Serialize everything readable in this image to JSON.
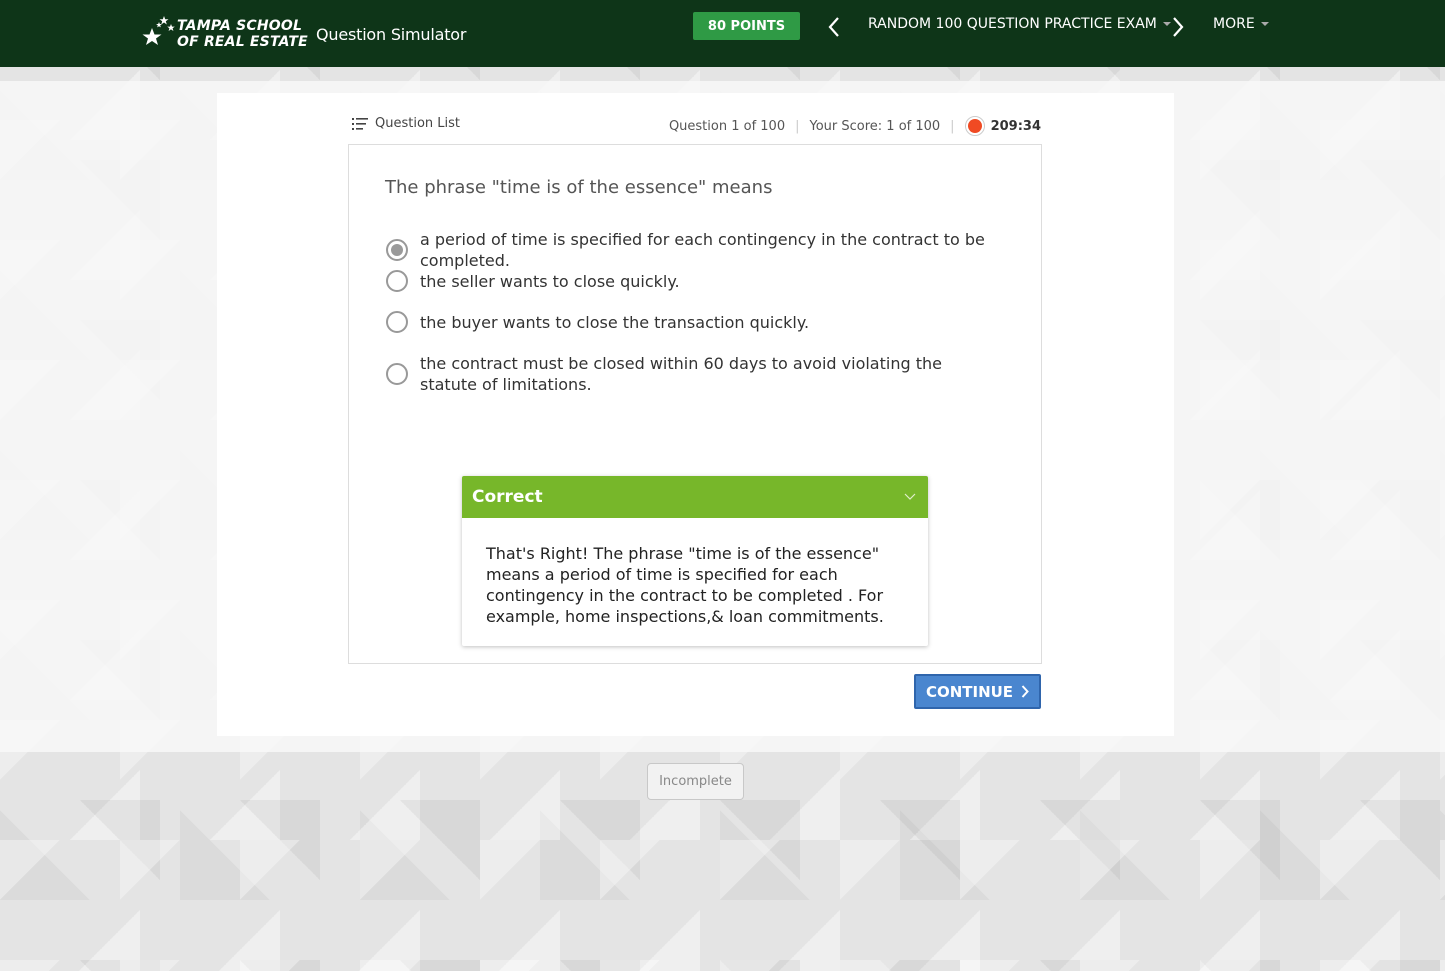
{
  "header": {
    "logo_line1": "TAMPA SCHOOL",
    "logo_line2": "OF REAL ESTATE",
    "app_name": "Question Simulator",
    "points": "80 POINTS",
    "exam_title": "RANDOM 100 QUESTION PRACTICE EXAM",
    "more_label": "MORE"
  },
  "toolbar": {
    "question_list_label": "Question List",
    "question_counter": "Question 1 of 100",
    "score": "Your Score: 1 of 100",
    "timer": "209:34"
  },
  "question": {
    "text": "The phrase \"time is of the essence\" means",
    "options": [
      {
        "label": "a period of time is specified for each contingency in the contract to be completed.",
        "selected": true
      },
      {
        "label": "the seller wants to close quickly.",
        "selected": false
      },
      {
        "label": "the buyer wants to close the transaction quickly.",
        "selected": false
      },
      {
        "label": "the contract must be closed within 60 days to avoid violating the statute of limitations.",
        "selected": false
      }
    ]
  },
  "feedback": {
    "status": "Correct",
    "explanation": "That's Right! The phrase \"time is of the essence\" means a period of time is specified for  each contingency in the contract to be completed . For example, home inspections,& loan commitments."
  },
  "actions": {
    "continue_label": "CONTINUE",
    "incomplete_label": "Incomplete"
  },
  "colors": {
    "header_bg": "#0e3518",
    "points_bg": "#2f9a45",
    "correct_bg": "#77b72a",
    "continue_bg": "#4a86cf",
    "timer_dot": "#f04a23"
  }
}
